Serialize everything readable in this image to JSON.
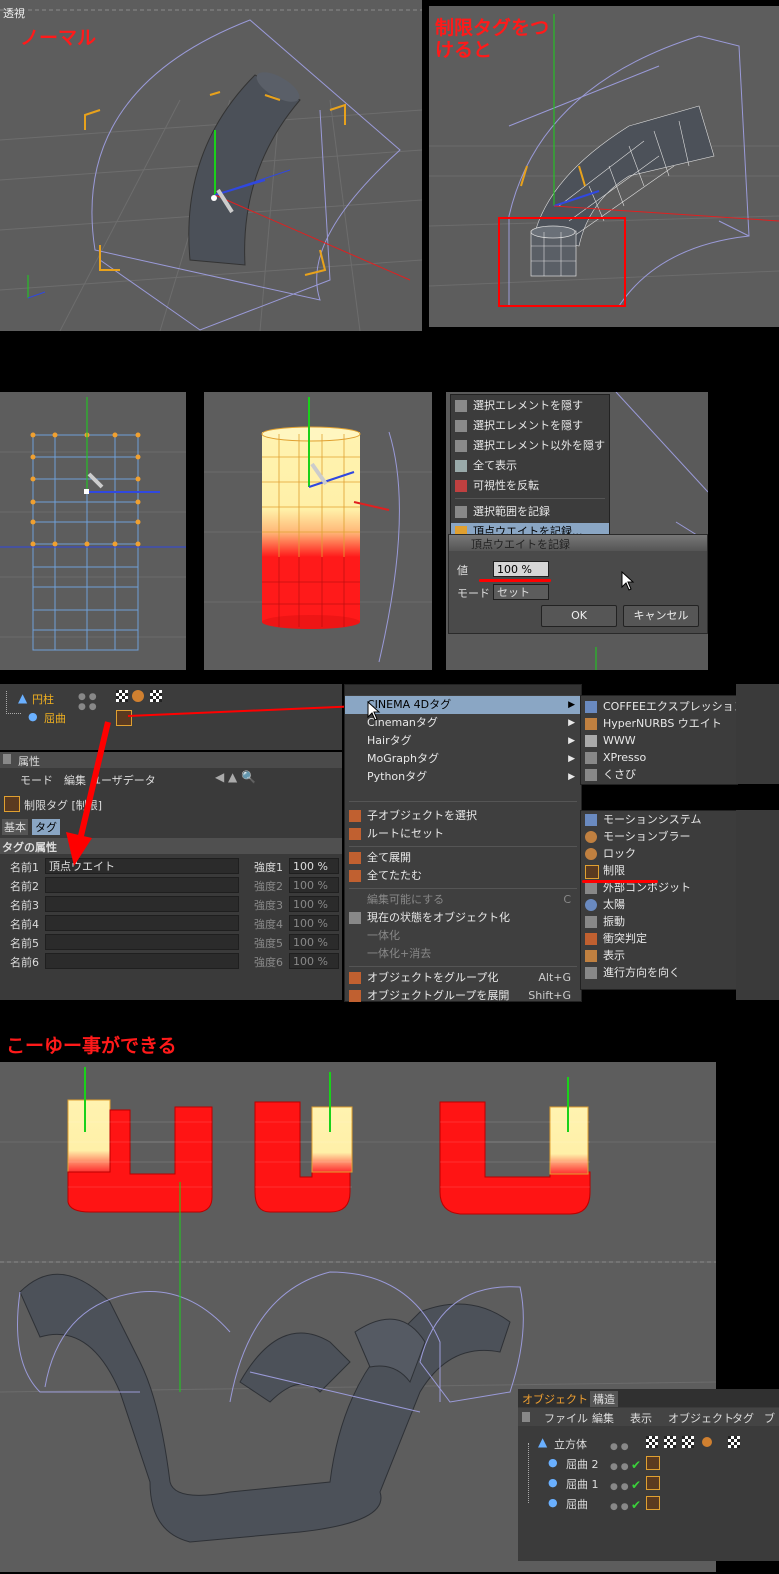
{
  "panel1": {
    "view_label": "透視",
    "caption": "ノーマル"
  },
  "panel2": {
    "caption_line1": "制限タグをつ",
    "caption_line2": "けると"
  },
  "context_menu": {
    "items": [
      {
        "label": "選択エレメントを隠す"
      },
      {
        "label": "選択エレメントを隠す"
      },
      {
        "label": "選択エレメント以外を隠す"
      },
      {
        "label": "全て表示"
      },
      {
        "label": "可視性を反転"
      },
      {
        "label": "選択範囲を記録"
      },
      {
        "label": "頂点ウエイトを記録..."
      }
    ],
    "dialog": {
      "title": "頂点ウエイトを記録",
      "value_label": "値",
      "value": "100 %",
      "mode_label": "モード",
      "mode_value": "セット",
      "ok": "OK",
      "cancel": "キャンセル"
    }
  },
  "object_manager_small": {
    "rows": [
      {
        "name": "円柱"
      },
      {
        "name": "屈曲"
      }
    ]
  },
  "attributes": {
    "header": "属性",
    "menu": [
      "モード",
      "編集",
      "ユーザデータ"
    ],
    "tag_title": "制限タグ [制限]",
    "tabs": [
      "基本",
      "タグ"
    ],
    "section": "タグの属性",
    "rows": [
      {
        "name_label": "名前1",
        "name_value": "頂点ウエイト",
        "strength_label": "強度1",
        "strength_value": "100 %",
        "active": true
      },
      {
        "name_label": "名前2",
        "name_value": "",
        "strength_label": "強度2",
        "strength_value": "100 %",
        "active": false
      },
      {
        "name_label": "名前3",
        "name_value": "",
        "strength_label": "強度3",
        "strength_value": "100 %",
        "active": false
      },
      {
        "name_label": "名前4",
        "name_value": "",
        "strength_label": "強度4",
        "strength_value": "100 %",
        "active": false
      },
      {
        "name_label": "名前5",
        "name_value": "",
        "strength_label": "強度5",
        "strength_value": "100 %",
        "active": false
      },
      {
        "name_label": "名前6",
        "name_value": "",
        "strength_label": "強度6",
        "strength_value": "100 %",
        "active": false
      }
    ]
  },
  "tag_menu": {
    "items": [
      {
        "label": "CINEMA 4Dタグ",
        "submenu": true,
        "selected": true
      },
      {
        "label": "Cinemanタグ",
        "submenu": true
      },
      {
        "label": "Hairタグ",
        "submenu": true
      },
      {
        "label": "MoGraphタグ",
        "submenu": true
      },
      {
        "label": "Pythonタグ",
        "submenu": true
      },
      {
        "label": "子オブジェクトを選択"
      },
      {
        "label": "ルートにセット"
      },
      {
        "label": "全て展開"
      },
      {
        "label": "全てたたむ"
      },
      {
        "label": "編集可能にする",
        "shortcut": "C",
        "disabled": true
      },
      {
        "label": "現在の状態をオブジェクト化"
      },
      {
        "label": "一体化",
        "disabled": true
      },
      {
        "label": "一体化+消去",
        "disabled": true
      },
      {
        "label": "オブジェクトをグループ化",
        "shortcut": "Alt+G"
      },
      {
        "label": "オブジェクトグループを展開",
        "shortcut": "Shift+G"
      }
    ],
    "submenu_top": [
      "COFFEEエクスプレッション",
      "HyperNURBS ウエイト",
      "WWW",
      "XPresso",
      "くさび"
    ],
    "submenu_bottom": [
      "モーションシステム",
      "モーションブラー",
      "ロック",
      "制限",
      "外部コンポジット",
      "太陽",
      "振動",
      "衝突判定",
      "表示",
      "進行方向を向く"
    ]
  },
  "caption_bottom": "こーゆー事ができる",
  "object_manager": {
    "tabs": [
      "オブジェクト",
      "構造"
    ],
    "menu": [
      "ファイル",
      "編集",
      "表示",
      "オブジェクト",
      "タグ",
      "ブ"
    ],
    "rows": [
      {
        "name": "立方体"
      },
      {
        "name": "屈曲 2"
      },
      {
        "name": "屈曲 1"
      },
      {
        "name": "屈曲"
      }
    ]
  },
  "colors": {
    "caption": "#ff1a1a",
    "viewport": "#5d5d5d",
    "panel": "#3a3a3a",
    "menu_selected": "#8aa6c4"
  }
}
